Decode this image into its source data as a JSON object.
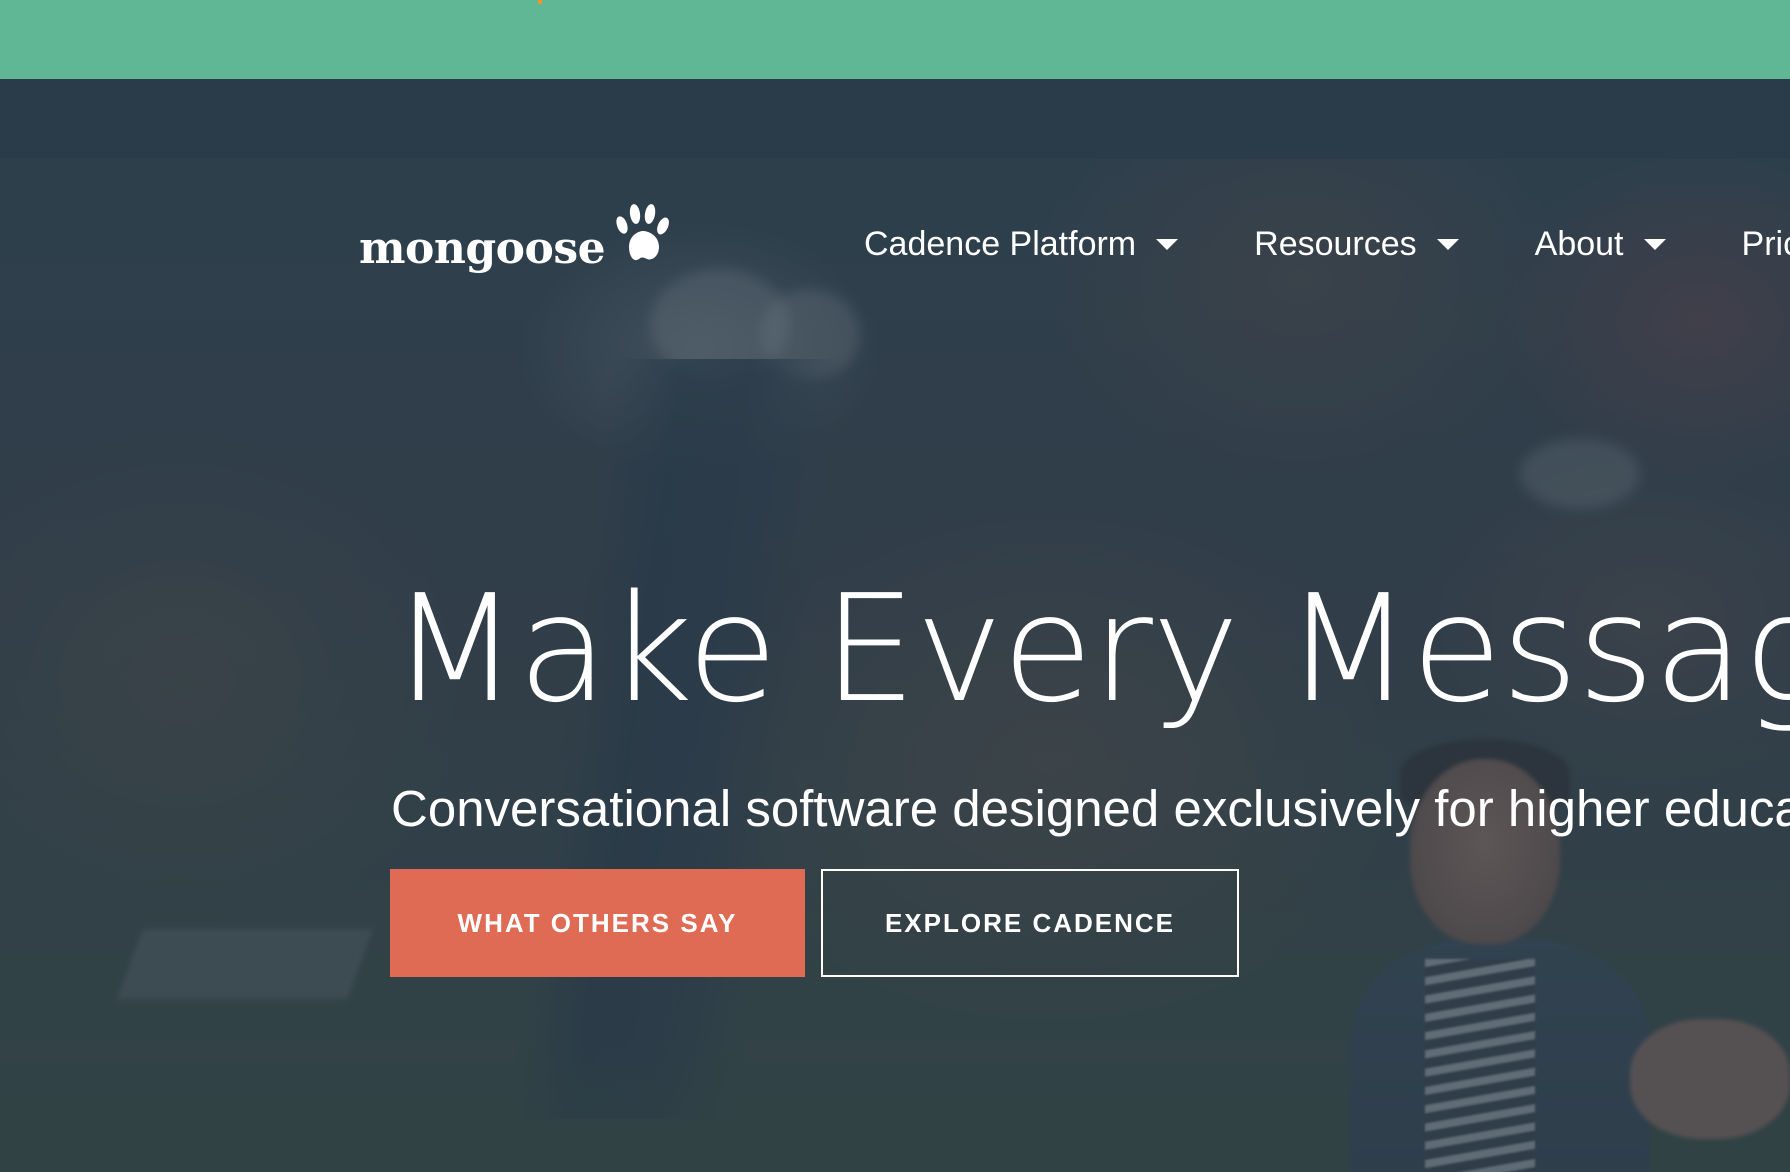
{
  "header": {
    "logo_text": "mongoose"
  },
  "nav": {
    "items": [
      {
        "label": "Cadence Platform"
      },
      {
        "label": "Resources"
      },
      {
        "label": "About"
      },
      {
        "label": "Pric"
      }
    ]
  },
  "hero": {
    "headline": "Make Every Message",
    "subheadline": "Conversational software designed exclusively for higher educati",
    "primary_button": "WHAT OTHERS SAY",
    "secondary_button": "EXPLORE CADENCE"
  },
  "colors": {
    "promo_bar": "#5fb795",
    "header_band": "#2a3c4a",
    "primary_button": "#e06b55",
    "text": "#ffffff"
  },
  "icons": {
    "logo_mark": "paw-icon",
    "nav_caret": "caret-down-icon"
  }
}
